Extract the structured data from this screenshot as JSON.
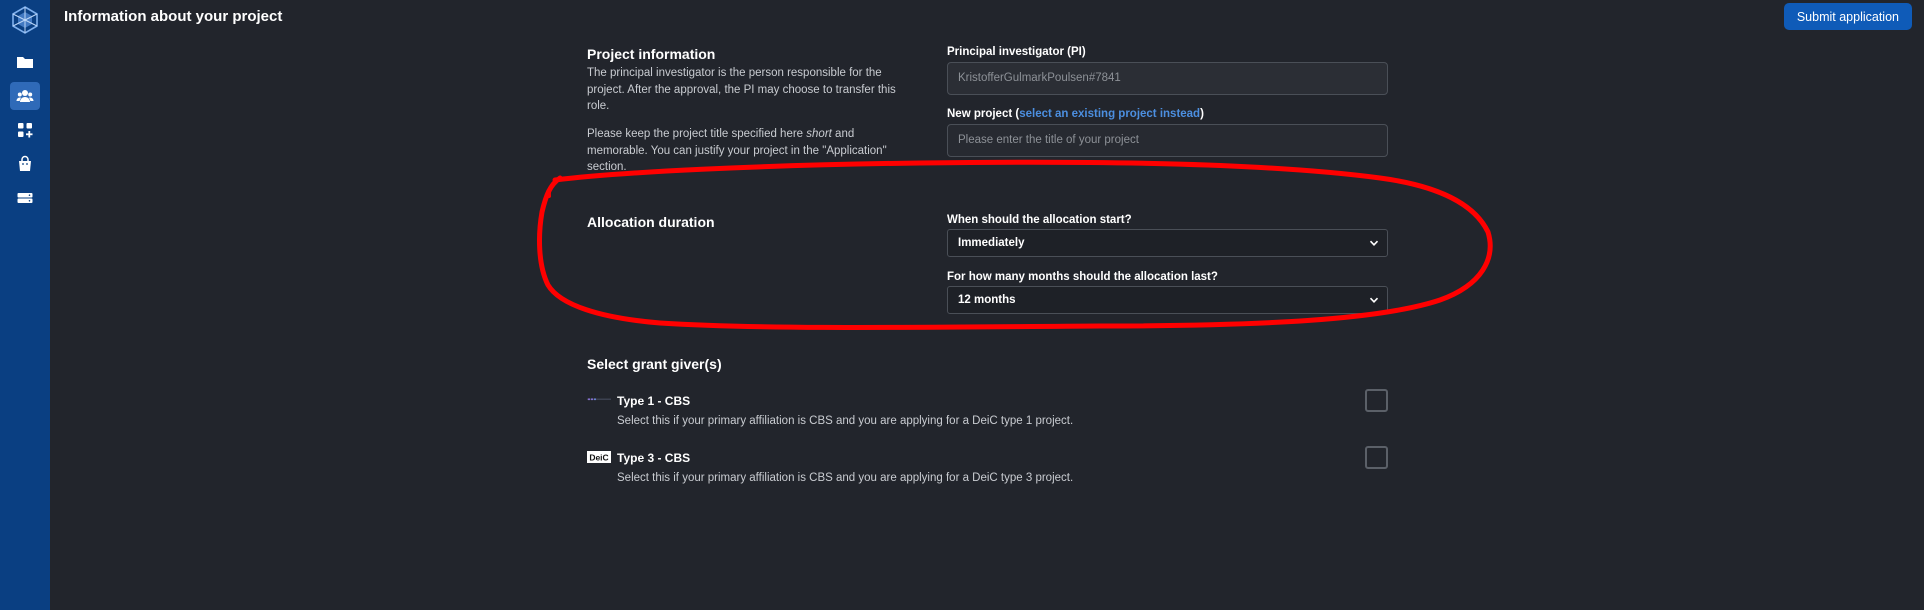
{
  "header": {
    "title": "Information about your project",
    "submit_label": "Submit application"
  },
  "sidebar": {
    "items": [
      {
        "icon": "folder-icon"
      },
      {
        "icon": "users-icon",
        "active": true
      },
      {
        "icon": "apps-icon"
      },
      {
        "icon": "shopping-bag-icon"
      },
      {
        "icon": "drive-icon"
      }
    ]
  },
  "project_info": {
    "title": "Project information",
    "para1": "The principal investigator is the person responsible for the project. After the approval, the PI may choose to transfer this role.",
    "para2_before": "Please keep the project title specified here ",
    "para2_emph": "short",
    "para2_after": " and memorable. You can justify your project in the \"Application\" section.",
    "pi_label": "Principal investigator (PI)",
    "pi_value": "KristofferGulmarkPoulsen#7841",
    "new_project_label_start": "New project (",
    "new_project_link": "select an existing project instead",
    "new_project_label_end": ")",
    "title_placeholder": "Please enter the title of your project"
  },
  "allocation": {
    "title": "Allocation duration",
    "start_label": "When should the allocation start?",
    "start_value": "Immediately",
    "months_label": "For how many months should the allocation last?",
    "months_value": "12 months"
  },
  "grant_givers": {
    "title": "Select grant giver(s)",
    "items": [
      {
        "title": "Type 1 - CBS",
        "description": "Select this if your primary affiliation is CBS and you are applying for a DeiC type 1 project.",
        "logo": "cbs-logo",
        "checked": false
      },
      {
        "title": "Type 3 - CBS",
        "description": "Select this if your primary affiliation is CBS and you are applying for a DeiC type 3 project.",
        "logo": "DeiC",
        "checked": false
      }
    ]
  },
  "colors": {
    "background": "#22252c",
    "sidebar": "#0a3f82",
    "primary": "#0f5bb8",
    "link": "#4c8fe0",
    "annotation": "#ff0000"
  }
}
